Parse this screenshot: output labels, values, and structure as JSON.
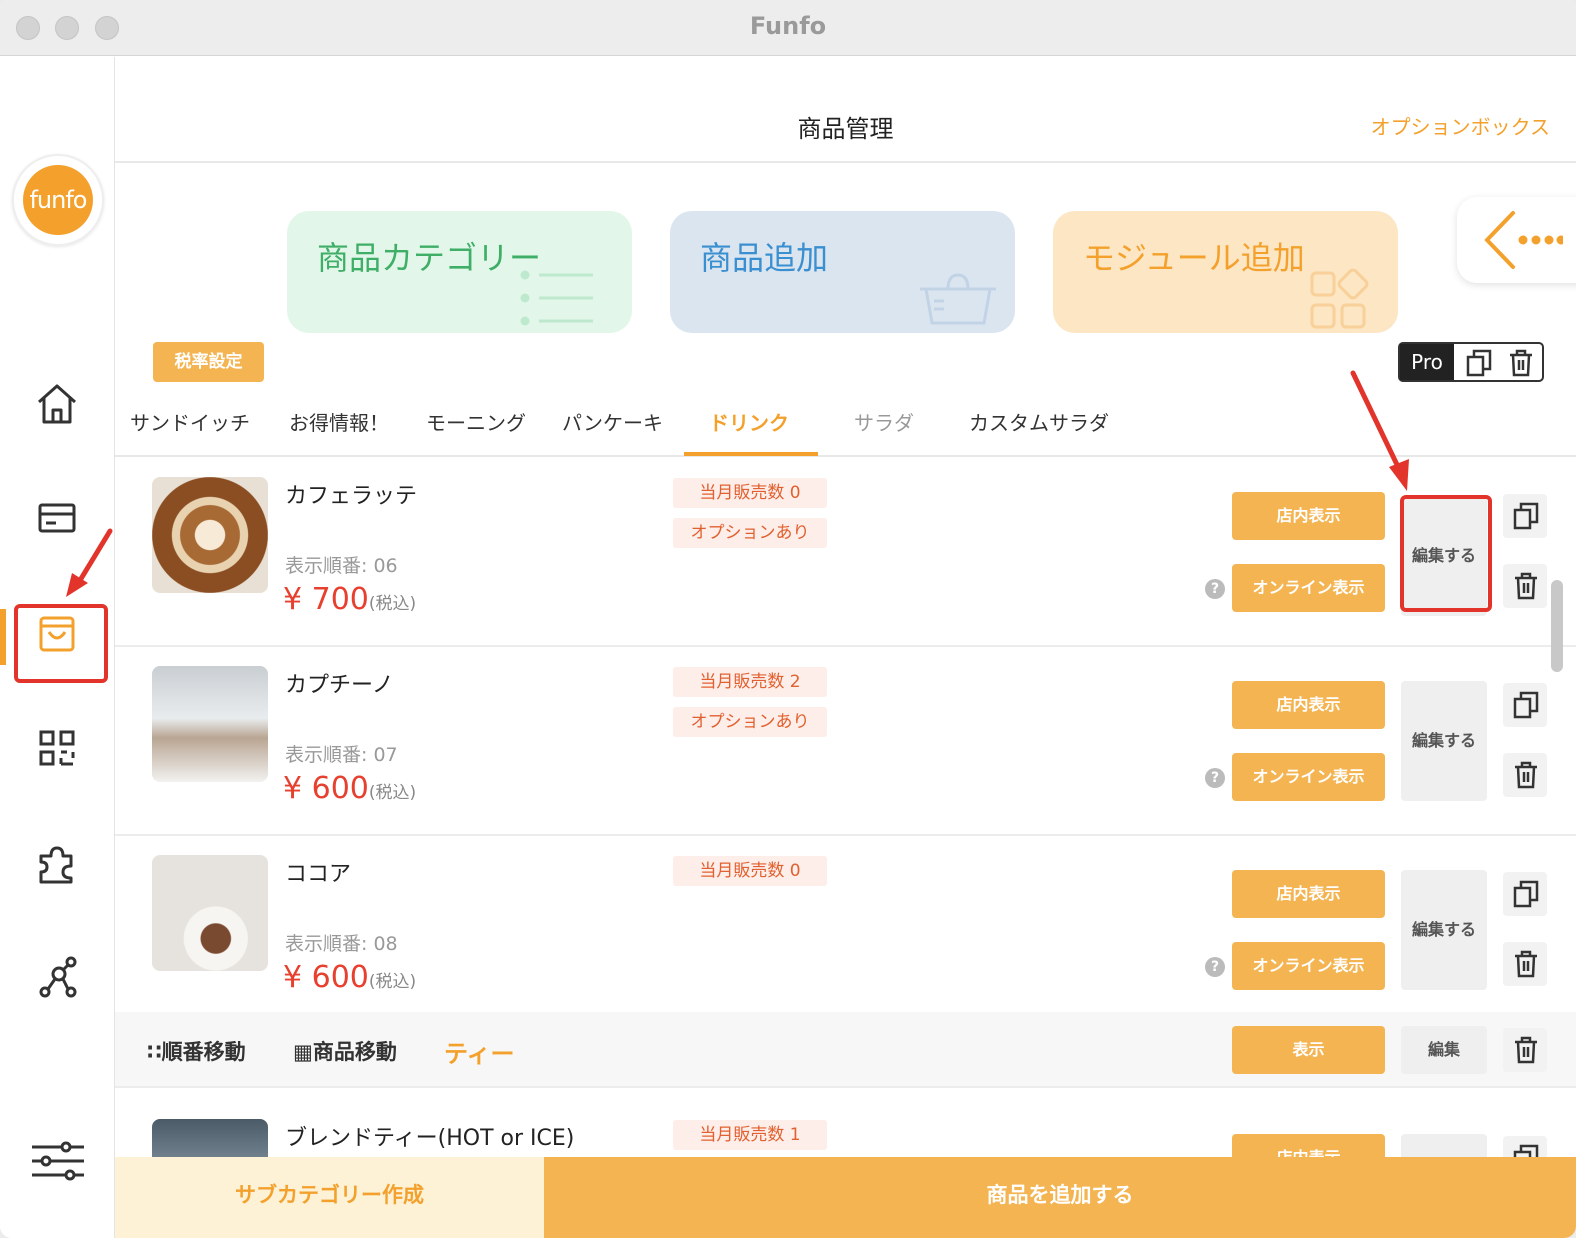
{
  "window": {
    "title": "Funfo"
  },
  "sidebar": {
    "logo_text": "funfo",
    "items": [
      {
        "name": "home",
        "icon": "home-icon"
      },
      {
        "name": "card",
        "icon": "card-icon"
      },
      {
        "name": "products",
        "icon": "shopping-bag-icon",
        "active": true
      },
      {
        "name": "qr",
        "icon": "qr-code-icon"
      },
      {
        "name": "modules",
        "icon": "puzzle-icon"
      },
      {
        "name": "network",
        "icon": "network-icon"
      },
      {
        "name": "settings",
        "icon": "sliders-icon"
      }
    ]
  },
  "header": {
    "title": "商品管理",
    "option_box": "オプションボックス"
  },
  "cards": {
    "category": "商品カテゴリー",
    "add_product": "商品追加",
    "add_module": "モジュール追加"
  },
  "toolbar": {
    "tax_setting": "税率設定",
    "pro": "Pro"
  },
  "tabs": [
    {
      "label": "サンドイッチ"
    },
    {
      "label": "お得情報！"
    },
    {
      "label": "モーニング"
    },
    {
      "label": "パンケーキ"
    },
    {
      "label": "ドリンク",
      "active": true
    },
    {
      "label": "サラダ"
    },
    {
      "label": "カスタムサラダ"
    }
  ],
  "products": [
    {
      "name": "カフェラッテ",
      "order": "表示順番: 06",
      "price": "¥ 700",
      "tax": "(税込)",
      "sales": "当月販売数 0",
      "option": "オプションあり"
    },
    {
      "name": "カプチーノ",
      "order": "表示順番: 07",
      "price": "¥ 600",
      "tax": "(税込)",
      "sales": "当月販売数 2",
      "option": "オプションあり"
    },
    {
      "name": "ココア",
      "order": "表示順番: 08",
      "price": "¥ 600",
      "tax": "(税込)",
      "sales": "当月販売数 0"
    },
    {
      "name": "ブレンドティー(HOT or ICE)",
      "sales": "当月販売数 1"
    }
  ],
  "buttons": {
    "store_display": "店内表示",
    "online_display": "オンライン表示",
    "edit": "編集する",
    "help": "?"
  },
  "subcategory": {
    "reorder": "順番移動",
    "move_product": "商品移動",
    "name": "ティー",
    "show": "表示",
    "edit": "編集"
  },
  "bottom": {
    "create_subcategory": "サブカテゴリー作成",
    "add_product": "商品を追加する"
  },
  "colors": {
    "accent": "#f3a12c",
    "price": "#e8402f",
    "annotation": "#e2342b"
  }
}
